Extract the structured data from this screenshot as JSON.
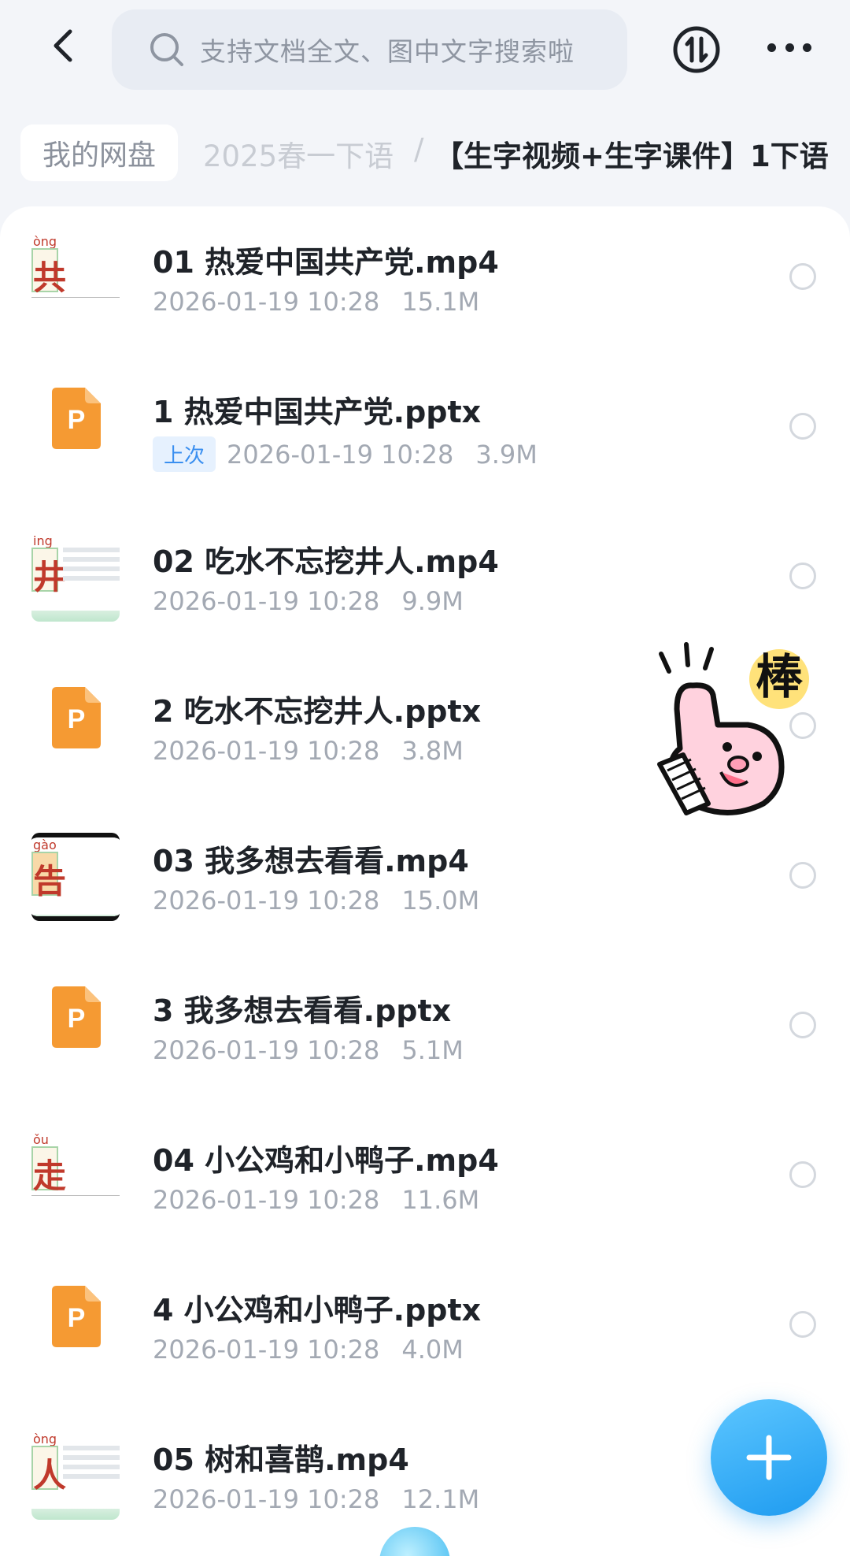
{
  "header": {
    "search_placeholder": "支持文档全文、图中文字搜索啦",
    "icons": {
      "back": "back-arrow-icon",
      "search": "search-icon",
      "sort": "sort-transfer-icon",
      "more": "more-dots-icon"
    }
  },
  "breadcrumb": {
    "root": "我的网盘",
    "middle": "2025春一下语",
    "separator": "/",
    "current": "【生字视频+生字课件】1下语"
  },
  "files": [
    {
      "name": "01 热爱中国共产党.mp4",
      "date": "2026-01-19 10:28",
      "size": "15.1M",
      "type": "video",
      "thumb_char": "共",
      "thumb_pinyin": "òng",
      "badge": ""
    },
    {
      "name": "1 热爱中国共产党.pptx",
      "date": "2026-01-19 10:28",
      "size": "3.9M",
      "type": "pptx",
      "badge": "上次"
    },
    {
      "name": "02 吃水不忘挖井人.mp4",
      "date": "2026-01-19 10:28",
      "size": "9.9M",
      "type": "video",
      "thumb_char": "井",
      "thumb_pinyin": "ing",
      "badge": ""
    },
    {
      "name": "2 吃水不忘挖井人.pptx",
      "date": "2026-01-19 10:28",
      "size": "3.8M",
      "type": "pptx",
      "badge": ""
    },
    {
      "name": "03 我多想去看看.mp4",
      "date": "2026-01-19 10:28",
      "size": "15.0M",
      "type": "video",
      "thumb_char": "告",
      "thumb_pinyin": "gào",
      "badge": ""
    },
    {
      "name": "3 我多想去看看.pptx",
      "date": "2026-01-19 10:28",
      "size": "5.1M",
      "type": "pptx",
      "badge": ""
    },
    {
      "name": "04 小公鸡和小鸭子.mp4",
      "date": "2026-01-19 10:28",
      "size": "11.6M",
      "type": "video",
      "thumb_char": "走",
      "thumb_pinyin": "ǒu",
      "badge": ""
    },
    {
      "name": "4 小公鸡和小鸭子.pptx",
      "date": "2026-01-19 10:28",
      "size": "4.0M",
      "type": "pptx",
      "badge": ""
    },
    {
      "name": "05 树和喜鹊.mp4",
      "date": "2026-01-19 10:28",
      "size": "12.1M",
      "type": "video",
      "thumb_char": "人",
      "thumb_pinyin": "òng",
      "badge": ""
    }
  ],
  "sticker": {
    "text": "棒",
    "icon": "thumbs-up-sticker-icon"
  },
  "fab": {
    "icon": "plus-icon"
  },
  "colors": {
    "accent": "#1e9bf0",
    "ppt_orange": "#f59a33",
    "badge_bg": "#e6f1fe",
    "badge_text": "#3a8ff0"
  }
}
